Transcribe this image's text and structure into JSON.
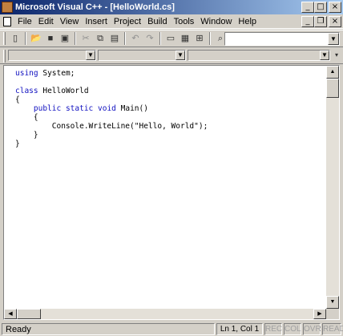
{
  "window": {
    "title": "Microsoft Visual C++ - [HelloWorld.cs]",
    "caption_buttons": [
      "_",
      "□",
      "×"
    ]
  },
  "menu": {
    "items": [
      "File",
      "Edit",
      "View",
      "Insert",
      "Project",
      "Build",
      "Tools",
      "Window",
      "Help"
    ],
    "mdi_buttons": [
      "_",
      "❐",
      "×"
    ]
  },
  "toolbar": {
    "icons": [
      "new-file-icon",
      "open-folder-icon",
      "save-icon",
      "save-all-icon",
      "cut-icon",
      "copy-icon",
      "paste-icon",
      "undo-icon",
      "redo-icon",
      "workspace-icon",
      "output-icon",
      "window-list-icon",
      "find-in-files-icon"
    ],
    "glyphs": [
      "▯",
      "📂",
      "■",
      "▣",
      "✂",
      "⧉",
      "▤",
      "↶",
      "↷",
      "▭",
      "▦",
      "⊞",
      "⌕"
    ],
    "find_value": "",
    "arrow": "▼"
  },
  "wizardbar": {
    "arrow": "▼"
  },
  "editor": {
    "lines": [
      "using System;",
      "",
      "class HelloWorld",
      "{",
      "    public static void Main()",
      "    {",
      "        Console.WriteLine(\"Hello, World\");",
      "    }",
      "}"
    ]
  },
  "scrollbars": {
    "up": "▲",
    "down": "▼",
    "left": "◀",
    "right": "▶"
  },
  "status": {
    "ready": "Ready",
    "position": "Ln 1, Col 1",
    "panes": [
      "REC",
      "COL",
      "OVR",
      "READ"
    ]
  },
  "colors": {
    "keyword": "#1010c0",
    "title_start": "#0a246a",
    "title_end": "#a6caf0"
  }
}
